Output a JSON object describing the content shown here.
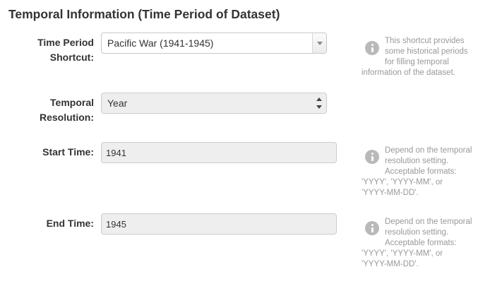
{
  "section": {
    "title": "Temporal Information (Time Period of Dataset)"
  },
  "fields": {
    "shortcut": {
      "label_line1": "Time Period",
      "label_line2": "Shortcut:",
      "value": "Pacific War (1941-1945)",
      "help": [
        "This shortcut provides",
        "some historical periods",
        "for filling temporal",
        "information of the dataset."
      ]
    },
    "resolution": {
      "label_line1": "Temporal",
      "label_line2": "Resolution:",
      "value": "Year"
    },
    "start_time": {
      "label": "Start Time:",
      "value": "1941",
      "help": [
        "Depend on the temporal",
        "resolution setting.",
        "Acceptable formats:",
        "'YYYY', 'YYYY-MM', or",
        "'YYYY-MM-DD'."
      ]
    },
    "end_time": {
      "label": "End Time:",
      "value": "1945",
      "help": [
        "Depend on the temporal",
        "resolution setting.",
        "Acceptable formats:",
        "'YYYY', 'YYYY-MM', or",
        "'YYYY-MM-DD'."
      ]
    }
  },
  "icons": {
    "help_icon": "info-circle-icon",
    "dropdown_icon": "chevron-down-icon",
    "updown_icon": "up-down-arrows-icon"
  }
}
